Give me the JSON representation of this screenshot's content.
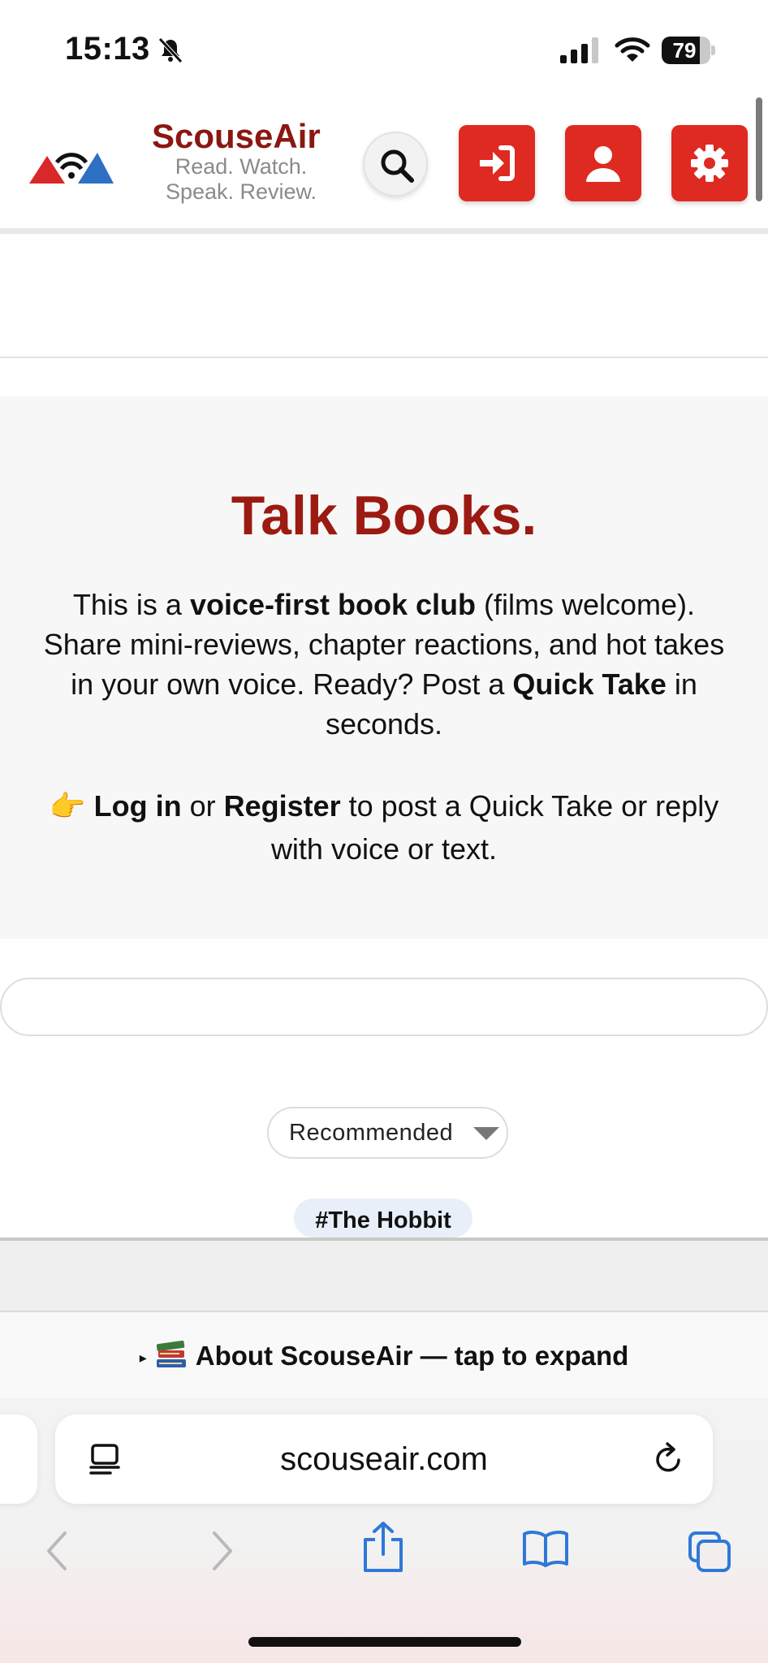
{
  "status_bar": {
    "time": "15:13",
    "battery": "79",
    "battery_level": 0.79,
    "icons": [
      "bell-muted-icon",
      "cellular-signal-icon",
      "wifi-icon",
      "battery-icon"
    ]
  },
  "header": {
    "brand_name": "ScouseAir",
    "tagline_line1": "Read. Watch.",
    "tagline_line2": "Speak. Review.",
    "icons": [
      "logo-icon",
      "search-icon",
      "login-icon",
      "user-icon",
      "gear-icon"
    ],
    "colors": {
      "brand": "#8b1712",
      "button": "#de2a20"
    }
  },
  "hero": {
    "title": "Talk Books.",
    "desc_p1": "This is a ",
    "desc_b1": "voice-first book club",
    "desc_p2": " (films welcome). Share mini-reviews, chapter reactions, and hot takes in your own voice. Ready? Post a ",
    "desc_b2": "Quick Take",
    "desc_p3": " in seconds.",
    "cta_emoji": "👉",
    "cta_login": "Log in",
    "cta_or": " or ",
    "cta_register": "Register",
    "cta_rest": " to post a Quick Take or reply with voice or text."
  },
  "feed": {
    "sort_selected": "Recommended",
    "tag": "#The Hobbit"
  },
  "about": {
    "arrow": "▸",
    "label": "About ScouseAir — tap to expand"
  },
  "browser": {
    "url": "scouseair.com",
    "icons": [
      "reader-icon",
      "reload-icon",
      "back-icon",
      "forward-icon",
      "share-icon",
      "bookmarks-icon",
      "tabs-icon"
    ]
  }
}
